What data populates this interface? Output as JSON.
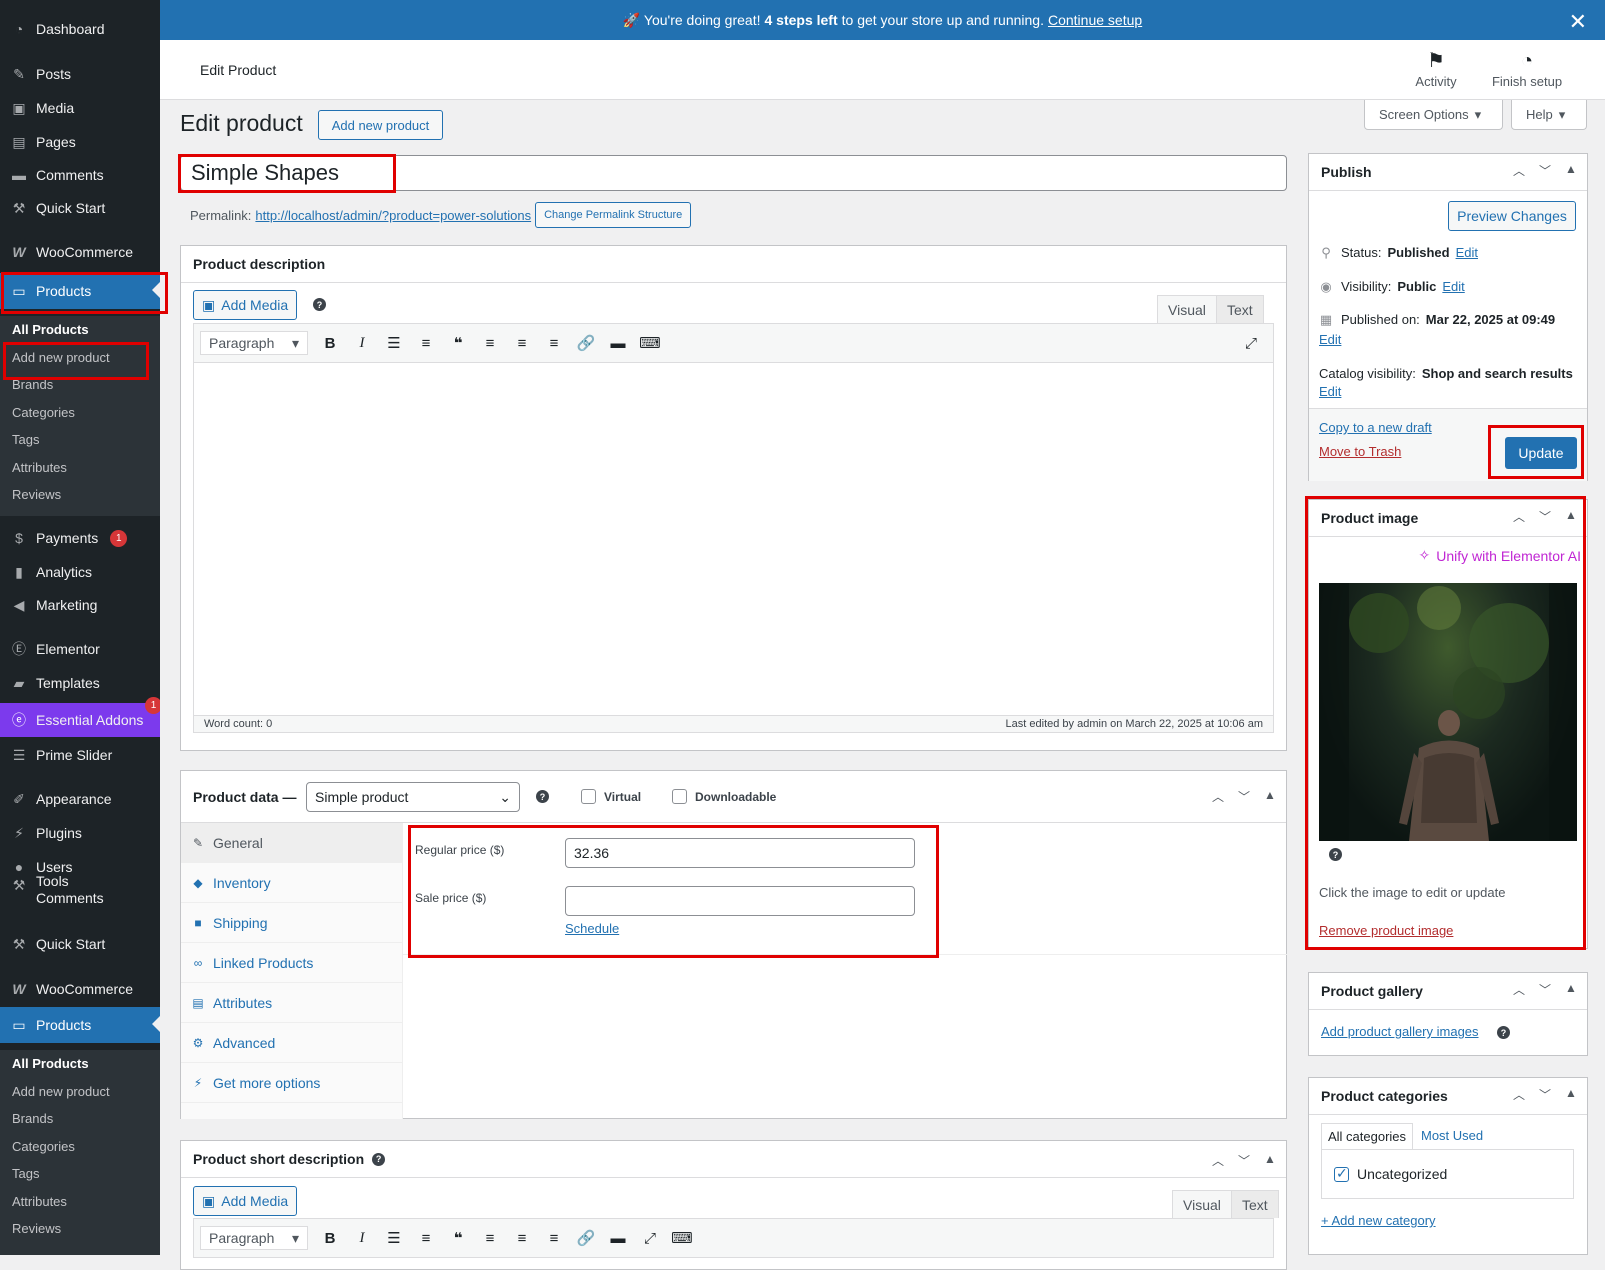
{
  "sidebar": {
    "top_items": [
      {
        "label": "Dashboard",
        "icon": "dashboard-icon"
      },
      {
        "label": "Posts",
        "icon": "pin-icon"
      },
      {
        "label": "Media",
        "icon": "media-icon"
      },
      {
        "label": "Pages",
        "icon": "pages-icon"
      },
      {
        "label": "Comments",
        "icon": "comment-icon"
      },
      {
        "label": "Quick Start",
        "icon": "tool-icon"
      },
      {
        "label": "WooCommerce",
        "icon": "woo-icon"
      },
      {
        "label": "Products",
        "icon": "products-icon"
      }
    ],
    "submenu": [
      "All Products",
      "Add new product",
      "Brands",
      "Categories",
      "Tags",
      "Attributes",
      "Reviews"
    ],
    "mid_items": [
      {
        "label": "Payments",
        "badge": "1"
      },
      {
        "label": "Analytics"
      },
      {
        "label": "Marketing"
      },
      {
        "label": "Elementor"
      },
      {
        "label": "Templates"
      },
      {
        "label": "Essential Addons",
        "badge": "1"
      },
      {
        "label": "Prime Slider"
      },
      {
        "label": "Appearance"
      },
      {
        "label": "Plugins"
      },
      {
        "label": "Users"
      },
      {
        "label": "Tools"
      },
      {
        "label": "Comments"
      },
      {
        "label": "Quick Start"
      },
      {
        "label": "WooCommerce"
      },
      {
        "label": "Products"
      }
    ],
    "submenu2": [
      "All Products",
      "Add new product",
      "Brands",
      "Categories",
      "Tags",
      "Attributes",
      "Reviews"
    ]
  },
  "notice": {
    "prefix": "🚀 You're doing great!",
    "bold": "4 steps left",
    "suffix": "to get your store up and running.",
    "link": "Continue setup"
  },
  "header": {
    "title": "Edit Product",
    "activity": "Activity",
    "finish": "Finish setup",
    "screen_options": "Screen Options",
    "help": "Help"
  },
  "page": {
    "heading": "Edit product",
    "add_new": "Add new product",
    "title_value": "Simple Shapes",
    "permalink_label": "Permalink:",
    "permalink_url": "http://localhost/admin/?product=power-solutions",
    "change_permalink": "Change Permalink Structure"
  },
  "description_box": {
    "title": "Product description",
    "add_media": "Add Media",
    "tab_visual": "Visual",
    "tab_text": "Text",
    "format": "Paragraph",
    "word_count": "Word count: 0",
    "last_edited": "Last edited by admin on March 22, 2025 at 10:06 am"
  },
  "product_data": {
    "label": "Product data —",
    "type": "Simple product",
    "virtual": "Virtual",
    "downloadable": "Downloadable",
    "tabs": [
      "General",
      "Inventory",
      "Shipping",
      "Linked Products",
      "Attributes",
      "Advanced",
      "Get more options"
    ],
    "regular_price_label": "Regular price ($)",
    "regular_price": "32.36",
    "sale_price_label": "Sale price ($)",
    "sale_price": "",
    "schedule": "Schedule"
  },
  "short_description": {
    "title": "Product short description",
    "add_media": "Add Media",
    "tab_visual": "Visual",
    "tab_text": "Text",
    "format": "Paragraph"
  },
  "publish": {
    "title": "Publish",
    "preview": "Preview Changes",
    "status_label": "Status:",
    "status": "Published",
    "visibility_label": "Visibility:",
    "visibility": "Public",
    "published_label": "Published on:",
    "published": "Mar 22, 2025 at 09:49",
    "catalog_label": "Catalog visibility:",
    "catalog": "Shop and search results",
    "edit": "Edit",
    "copy_draft": "Copy to a new draft",
    "trash": "Move to Trash",
    "update": "Update"
  },
  "product_image": {
    "title": "Product image",
    "unify": "Unify with Elementor AI",
    "hint": "Click the image to edit or update",
    "remove": "Remove product image"
  },
  "gallery": {
    "title": "Product gallery",
    "add": "Add product gallery images"
  },
  "categories": {
    "title": "Product categories",
    "tab_all": "All categories",
    "tab_most": "Most Used",
    "item": "Uncategorized",
    "add_new": "+ Add new category"
  },
  "colors": {
    "accent": "#2271b1",
    "sidebar": "#1d2327",
    "highlight": "#e00000",
    "ea_purple": "#7c3aed"
  }
}
